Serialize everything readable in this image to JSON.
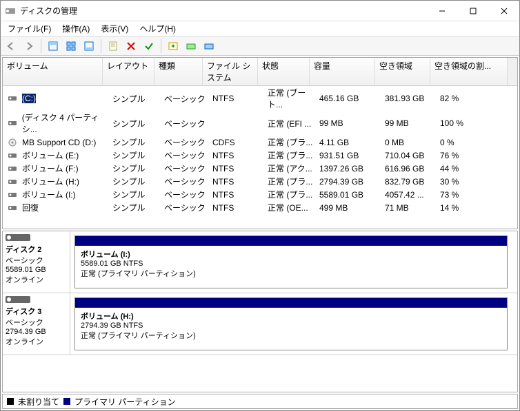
{
  "window": {
    "title": "ディスクの管理"
  },
  "menu": {
    "file": "ファイル(F)",
    "action": "操作(A)",
    "view": "表示(V)",
    "help": "ヘルプ(H)"
  },
  "columns": {
    "volume": "ボリューム",
    "layout": "レイアウト",
    "type": "種類",
    "fs": "ファイル システム",
    "status": "状態",
    "capacity": "容量",
    "free": "空き領域",
    "pct": "空き領域の割..."
  },
  "volumes": [
    {
      "name": "(C:)",
      "layout": "シンプル",
      "type": "ベーシック",
      "fs": "NTFS",
      "status": "正常 (ブート...",
      "capacity": "465.16 GB",
      "free": "381.93 GB",
      "pct": "82 %",
      "selected": true
    },
    {
      "name": "(ディスク 4 パーティシ...",
      "layout": "シンプル",
      "type": "ベーシック",
      "fs": "",
      "status": "正常 (EFI ...",
      "capacity": "99 MB",
      "free": "99 MB",
      "pct": "100 %"
    },
    {
      "name": "MB Support CD (D:)",
      "layout": "シンプル",
      "type": "ベーシック",
      "fs": "CDFS",
      "status": "正常 (プラ...",
      "capacity": "4.11 GB",
      "free": "0 MB",
      "pct": "0 %",
      "cd": true
    },
    {
      "name": "ボリューム (E:)",
      "layout": "シンプル",
      "type": "ベーシック",
      "fs": "NTFS",
      "status": "正常 (プラ...",
      "capacity": "931.51 GB",
      "free": "710.04 GB",
      "pct": "76 %"
    },
    {
      "name": "ボリューム (F:)",
      "layout": "シンプル",
      "type": "ベーシック",
      "fs": "NTFS",
      "status": "正常 (アク...",
      "capacity": "1397.26 GB",
      "free": "616.96 GB",
      "pct": "44 %"
    },
    {
      "name": "ボリューム (H:)",
      "layout": "シンプル",
      "type": "ベーシック",
      "fs": "NTFS",
      "status": "正常 (プラ...",
      "capacity": "2794.39 GB",
      "free": "832.79 GB",
      "pct": "30 %"
    },
    {
      "name": "ボリューム (I:)",
      "layout": "シンプル",
      "type": "ベーシック",
      "fs": "NTFS",
      "status": "正常 (プラ...",
      "capacity": "5589.01 GB",
      "free": "4057.42 ...",
      "pct": "73 %"
    },
    {
      "name": "回復",
      "layout": "シンプル",
      "type": "ベーシック",
      "fs": "NTFS",
      "status": "正常 (OE...",
      "capacity": "499 MB",
      "free": "71 MB",
      "pct": "14 %"
    }
  ],
  "disks": [
    {
      "title": "ディスク 2",
      "type": "ベーシック",
      "size": "5589.01 GB",
      "status": "オンライン",
      "part": {
        "name": "ボリューム  (I:)",
        "detail": "5589.01 GB NTFS",
        "state": "正常 (プライマリ パーティション)"
      }
    },
    {
      "title": "ディスク 3",
      "type": "ベーシック",
      "size": "2794.39 GB",
      "status": "オンライン",
      "part": {
        "name": "ボリューム  (H:)",
        "detail": "2794.39 GB NTFS",
        "state": "正常 (プライマリ パーティション)"
      }
    }
  ],
  "legend": {
    "unalloc": "未割り当て",
    "primary": "プライマリ パーティション"
  }
}
